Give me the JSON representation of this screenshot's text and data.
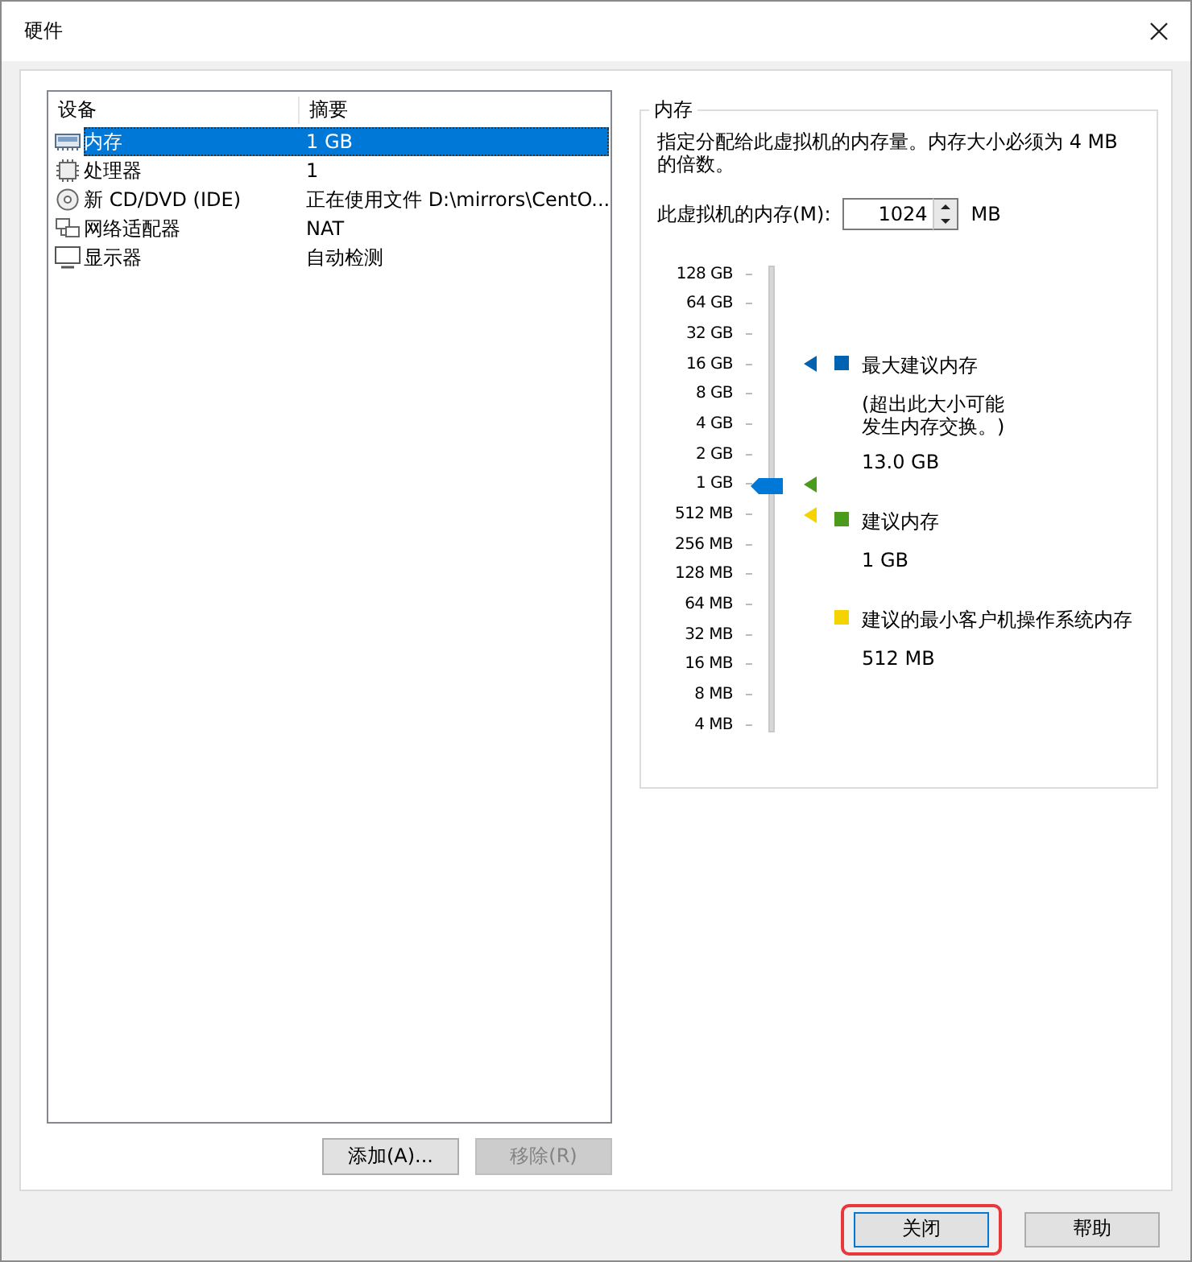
{
  "window": {
    "title": "硬件"
  },
  "device_list": {
    "columns": [
      "设备",
      "摘要"
    ],
    "rows": [
      {
        "kind": "memory",
        "device": "内存",
        "summary": "1 GB",
        "selected": true
      },
      {
        "kind": "cpu",
        "device": "处理器",
        "summary": "1",
        "selected": false
      },
      {
        "kind": "disc",
        "device": "新 CD/DVD (IDE)",
        "summary": "正在使用文件 D:\\mirrors\\CentO...",
        "selected": false
      },
      {
        "kind": "network",
        "device": "网络适配器",
        "summary": "NAT",
        "selected": false
      },
      {
        "kind": "display",
        "device": "显示器",
        "summary": "自动检测",
        "selected": false
      }
    ]
  },
  "list_buttons": [
    {
      "label": "添加(A)...",
      "disabled": false
    },
    {
      "label": "移除(R)",
      "disabled": true
    }
  ],
  "memory": {
    "title": "内存",
    "description": "指定分配给此虚拟机的内存量。内存大小必须为 4 MB 的倍数。",
    "field_label": "此虚拟机的内存(M):",
    "value": "1024",
    "unit": "MB",
    "scale": [
      "128 GB",
      "64 GB",
      "32 GB",
      "16 GB",
      "8 GB",
      "4 GB",
      "2 GB",
      "1 GB",
      "512 MB",
      "256 MB",
      "128 MB",
      "64 MB",
      "32 MB",
      "16 MB",
      "8 MB",
      "4 MB"
    ],
    "slider": {
      "level": 0.533
    },
    "legend": [
      {
        "label": "最大建议内存",
        "note": "(超出此大小可能发生内存交换。)",
        "value": "13.0 GB",
        "color": "#0063b1"
      },
      {
        "label": "建议内存",
        "value": "1 GB",
        "color": "#4a9a1c"
      },
      {
        "label": "建议的最小客户机操作系统内存",
        "value": "512 MB",
        "color": "#f5d300"
      }
    ]
  },
  "footer_buttons": [
    {
      "label": "关闭",
      "default": true,
      "highlighted": true
    },
    {
      "label": "帮助",
      "default": false,
      "highlighted": false
    }
  ]
}
